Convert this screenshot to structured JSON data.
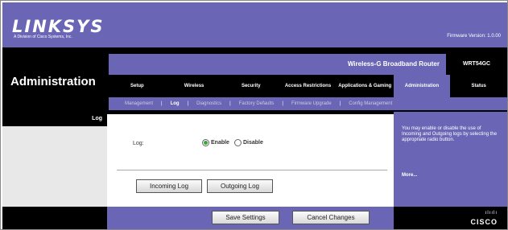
{
  "brand": {
    "logo": "LINKSYS",
    "tagline": "A Division of Cisco Systems, Inc.",
    "firmware": "Firmware Version: 1.0.00"
  },
  "product": {
    "name": "Wireless-G Broadband Router",
    "model": "WRT54GC"
  },
  "page_title": "Administration",
  "tabs": [
    {
      "label": "Setup",
      "active": false
    },
    {
      "label": "Wireless",
      "active": false
    },
    {
      "label": "Security",
      "active": false
    },
    {
      "label": "Access Restrictions",
      "active": false
    },
    {
      "label": "Applications & Gaming",
      "active": false
    },
    {
      "label": "Administration",
      "active": true
    },
    {
      "label": "Status",
      "active": false
    }
  ],
  "subtabs": [
    {
      "label": "Management",
      "active": false
    },
    {
      "label": "Log",
      "active": true
    },
    {
      "label": "Diagnostics",
      "active": false
    },
    {
      "label": "Factory Defaults",
      "active": false
    },
    {
      "label": "Firmware Upgrade",
      "active": false
    },
    {
      "label": "Config Management",
      "active": false
    }
  ],
  "section": {
    "label": "Log"
  },
  "log": {
    "label": "Log:",
    "options": [
      "Enable",
      "Disable"
    ],
    "selected": "Enable"
  },
  "buttons": {
    "incoming": "Incoming Log",
    "outgoing": "Outgoing Log",
    "save": "Save Settings",
    "cancel": "Cancel Changes"
  },
  "help": {
    "text": "You may enable or disable the use of Incoming and Outgoing logs by selecting the appropriate radio button.",
    "more": "More..."
  },
  "footer": {
    "bars": "ılıılı",
    "cisco": "CISCO"
  }
}
